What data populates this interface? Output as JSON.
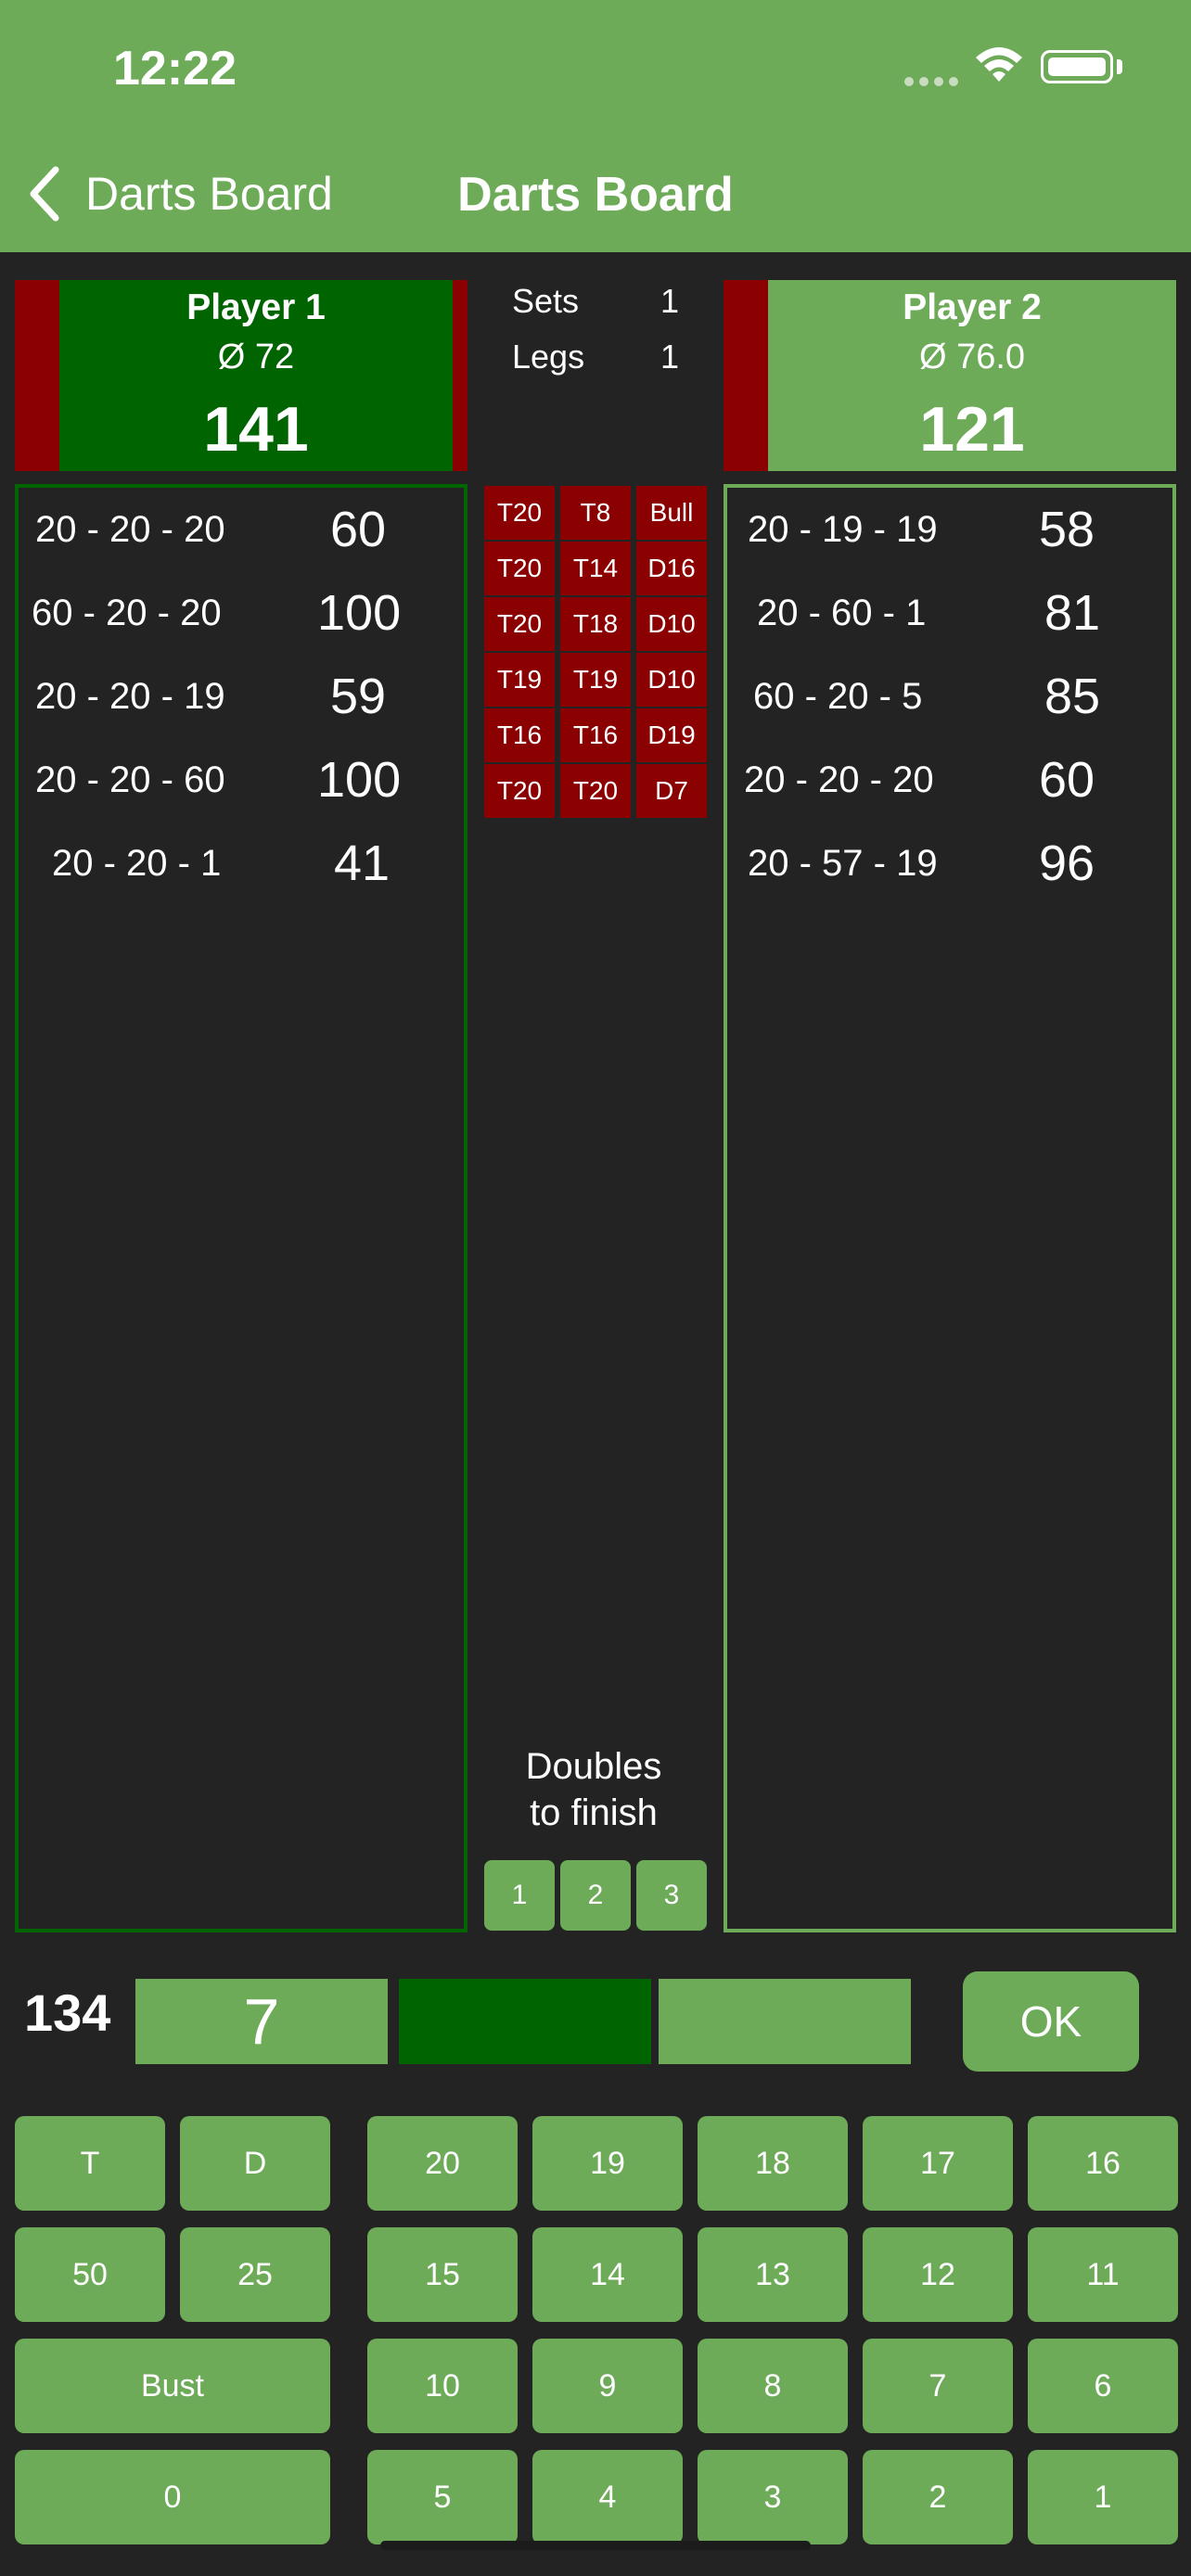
{
  "status_bar": {
    "time": "12:22"
  },
  "nav": {
    "back_label": "Darts Board",
    "title": "Darts Board"
  },
  "colors": {
    "header": "#6dab59",
    "dark_green": "#006400",
    "red": "#8b0000",
    "bg": "#232323"
  },
  "player1": {
    "name": "Player 1",
    "average": "Ø 72",
    "score": "141",
    "history": [
      {
        "darts": "20 - 20 - 20",
        "score": "60"
      },
      {
        "darts": "60 - 20 - 20",
        "score": "100"
      },
      {
        "darts": "20 - 20 - 19",
        "score": "59"
      },
      {
        "darts": "20 - 20 - 60",
        "score": "100"
      },
      {
        "darts": "20 - 20 - 1",
        "score": "41"
      }
    ]
  },
  "player2": {
    "name": "Player 2",
    "average": "Ø 76.0",
    "score": "121",
    "history": [
      {
        "darts": "20 - 19 - 19",
        "score": "58"
      },
      {
        "darts": "20 - 60 - 1",
        "score": "81"
      },
      {
        "darts": "60 - 20 - 5",
        "score": "85"
      },
      {
        "darts": "20 - 20 - 20",
        "score": "60"
      },
      {
        "darts": "20 - 57 - 19",
        "score": "96"
      }
    ]
  },
  "match": {
    "sets_label": "Sets",
    "sets_value": "1",
    "legs_label": "Legs",
    "legs_value": "1"
  },
  "checkouts": [
    [
      "T20",
      "T8",
      "Bull"
    ],
    [
      "T20",
      "T14",
      "D16"
    ],
    [
      "T20",
      "T18",
      "D10"
    ],
    [
      "T19",
      "T19",
      "D10"
    ],
    [
      "T16",
      "T16",
      "D19"
    ],
    [
      "T20",
      "T20",
      "D7"
    ]
  ],
  "doubles": {
    "label_line1": "Doubles",
    "label_line2": "to finish",
    "options": [
      "1",
      "2",
      "3"
    ]
  },
  "input": {
    "remaining": "134",
    "dart1": "7",
    "dart2": "",
    "dart3": "",
    "ok_label": "OK"
  },
  "keypad": {
    "modifiers": [
      [
        "T",
        "D"
      ],
      [
        "50",
        "25"
      ]
    ],
    "bust": "Bust",
    "zero": "0",
    "numbers": [
      [
        "20",
        "19",
        "18",
        "17",
        "16"
      ],
      [
        "15",
        "14",
        "13",
        "12",
        "11"
      ],
      [
        "10",
        "9",
        "8",
        "7",
        "6"
      ],
      [
        "5",
        "4",
        "3",
        "2",
        "1"
      ]
    ]
  }
}
